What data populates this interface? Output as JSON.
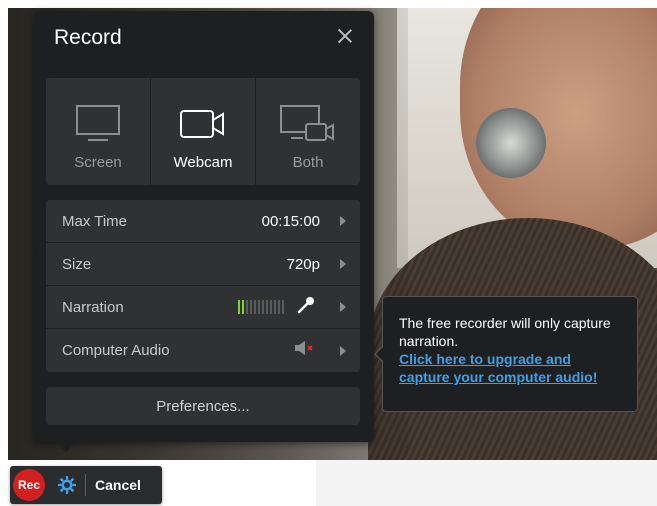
{
  "recorder": {
    "title": "Record",
    "modes": [
      {
        "label": "Screen",
        "icon": "monitor-icon",
        "selected": false
      },
      {
        "label": "Webcam",
        "icon": "webcam-icon",
        "selected": true
      },
      {
        "label": "Both",
        "icon": "monitor-webcam-icon",
        "selected": false
      }
    ],
    "settings": {
      "max_time": {
        "label": "Max Time",
        "value": "00:15:00"
      },
      "size": {
        "label": "Size",
        "value": "720p"
      },
      "narration": {
        "label": "Narration",
        "level_fraction": 0.17,
        "icon": "microphone-icon"
      },
      "computer_audio": {
        "label": "Computer Audio",
        "icon": "speaker-muted-icon"
      }
    },
    "preferences_label": "Preferences..."
  },
  "tooltip": {
    "text": "The free recorder will only capture narration.",
    "link": "Click here to upgrade and capture your computer audio!"
  },
  "toolbar": {
    "rec_label": "Rec",
    "cancel_label": "Cancel"
  },
  "colors": {
    "panel_bg": "#1d1f20",
    "row_bg": "#2f3133",
    "meter_active": "#7cd332",
    "rec_red": "#d21f1f",
    "link_blue": "#3ea1e8",
    "gear_blue": "#3ea1e8"
  }
}
